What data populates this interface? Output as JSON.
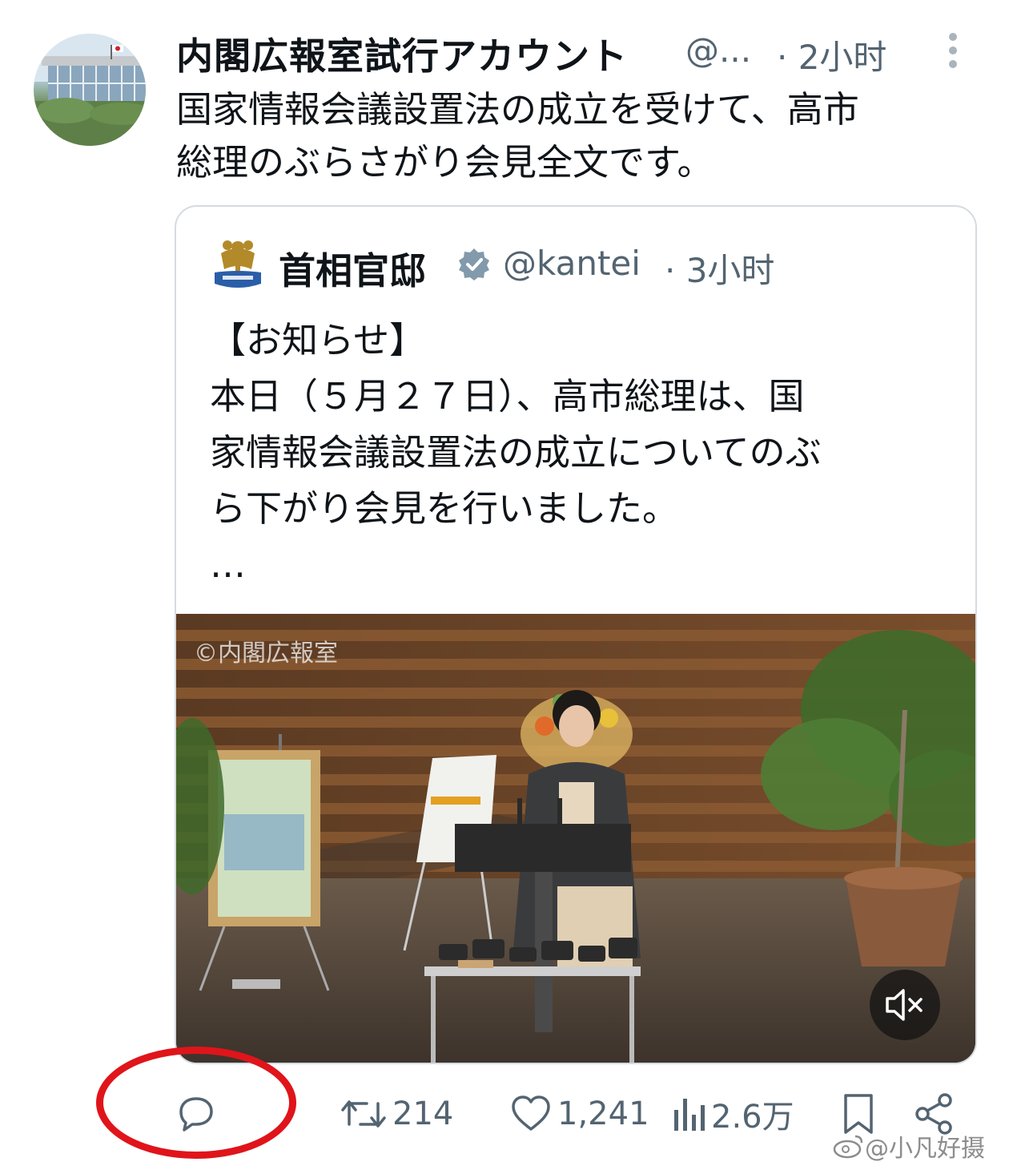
{
  "post": {
    "display_name": "内閣広報室試行アカウント",
    "handle": "@...",
    "time": "· 2小时",
    "text_lines": [
      "国家情報会議設置法の成立を受けて、高市",
      "総理のぶらさがり会見全文です。"
    ]
  },
  "quoted": {
    "display_name": "首相官邸",
    "handle": "@kantei",
    "time": "· 3小时",
    "text_lines": [
      "【お知らせ】",
      "本日（５月２７日）、高市総理は、国",
      "家情報会議設置法の成立についてのぶ",
      "ら下がり会見を行いました。",
      "…"
    ],
    "video": {
      "watermark": "©内閣広報室",
      "mute_icon": "speaker-muted-icon"
    }
  },
  "actions": {
    "reply_count": "",
    "retweet_count": "214",
    "like_count": "1,241",
    "views_count": "2.6万"
  },
  "overlay": {
    "weibo_watermark": "@小凡好摄",
    "highlight_color": "#e0141b"
  },
  "colors": {
    "text": "#0f1419",
    "secondary": "#536471",
    "border": "#d5dbe0",
    "verified": "#829aab"
  }
}
